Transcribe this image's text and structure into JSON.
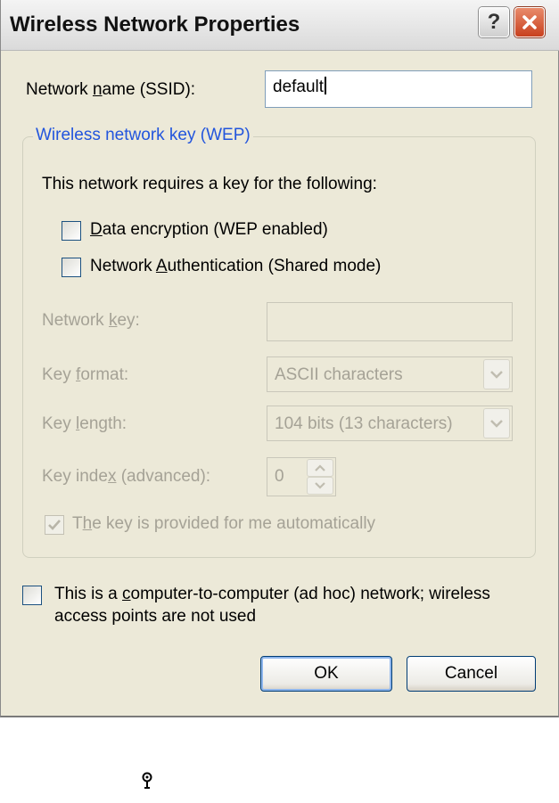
{
  "window": {
    "title": "Wireless Network Properties",
    "help_label": "?"
  },
  "ssid": {
    "label_pre": "Network ",
    "label_u": "n",
    "label_post": "ame (SSID):",
    "value": "default"
  },
  "wep_group": {
    "title": "Wireless network key (WEP)",
    "requires_text": "This network requires a key for the following:",
    "data_encryption": {
      "label_pre": "",
      "label_u": "D",
      "label_post": "ata encryption (WEP enabled)",
      "checked": false
    },
    "network_auth": {
      "label_pre": "Network ",
      "label_u": "A",
      "label_post": "uthentication (Shared mode)",
      "checked": false
    },
    "network_key": {
      "label_pre": "Network ",
      "label_u": "k",
      "label_post": "ey:",
      "value": ""
    },
    "key_format": {
      "label_pre": "Key ",
      "label_u": "f",
      "label_post": "ormat:",
      "value": "ASCII characters"
    },
    "key_length": {
      "label_pre": "Key ",
      "label_u": "l",
      "label_post": "ength:",
      "value": "104 bits (13 characters)"
    },
    "key_index": {
      "label_pre": "Key inde",
      "label_u": "x",
      "label_post": " (advanced):",
      "value": "0"
    },
    "auto_key": {
      "label_pre": "T",
      "label_u": "h",
      "label_post": "e key is provided for me automatically",
      "checked": true
    }
  },
  "adhoc": {
    "line1_pre": "This is a ",
    "line1_u": "c",
    "line1_post": "omputer-to-computer (ad hoc) network; wireless",
    "line2": "access points are not used",
    "checked": false
  },
  "buttons": {
    "ok": "OK",
    "cancel": "Cancel"
  },
  "colors": {
    "dialog_bg": "#ece9d8",
    "group_title": "#2255dd",
    "disabled_text": "#a5a296",
    "close_button": "#c8401e"
  },
  "icons": [
    "help-icon",
    "close-icon",
    "checkmark-icon",
    "dropdown-arrow-icon",
    "spin-up-icon",
    "spin-down-icon",
    "wireless-antenna-icon"
  ]
}
